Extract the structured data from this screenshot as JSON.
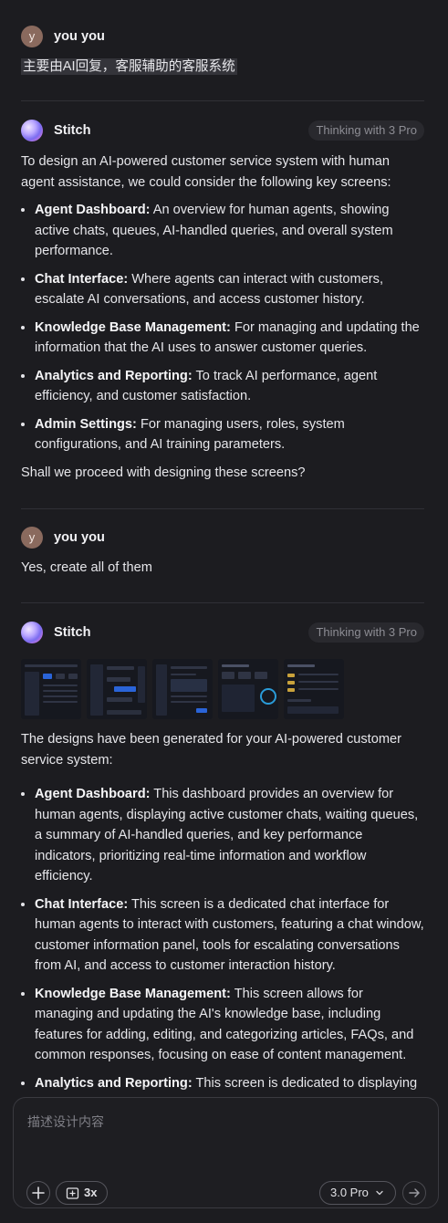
{
  "messages": {
    "m1": {
      "avatar": "y",
      "name": "you you",
      "text": "主要由AI回复，客服辅助的客服系统"
    },
    "m2": {
      "name": "Stitch",
      "badge": "Thinking with 3 Pro",
      "intro": "To design an AI-powered customer service system with human agent assistance, we could consider the following key screens:",
      "items": [
        {
          "title": "Agent Dashboard:",
          "text": " An overview for human agents, showing active chats, queues, AI-handled queries, and overall system performance."
        },
        {
          "title": "Chat Interface:",
          "text": " Where agents can interact with customers, escalate AI conversations, and access customer history."
        },
        {
          "title": "Knowledge Base Management:",
          "text": " For managing and updating the information that the AI uses to answer customer queries."
        },
        {
          "title": "Analytics and Reporting:",
          "text": " To track AI performance, agent efficiency, and customer satisfaction."
        },
        {
          "title": "Admin Settings:",
          "text": " For managing users, roles, system configurations, and AI training parameters."
        }
      ],
      "outro": "Shall we proceed with designing these screens?"
    },
    "m3": {
      "avatar": "y",
      "name": "you you",
      "text": "Yes, create all of them"
    },
    "m4": {
      "name": "Stitch",
      "badge": "Thinking with 3 Pro",
      "thumbnails": [
        "Agent Dashboard",
        "Chat Interface",
        "Knowledge Base Management",
        "Analytics and Reporting",
        "Admin Settings"
      ],
      "intro": "The designs have been generated for your AI-powered customer service system:",
      "items": [
        {
          "title": "Agent Dashboard:",
          "text": " This dashboard provides an overview for human agents, displaying active customer chats, waiting queues, a summary of AI-handled queries, and key performance indicators, prioritizing real-time information and workflow efficiency."
        },
        {
          "title": "Chat Interface:",
          "text": " This screen is a dedicated chat interface for human agents to interact with customers, featuring a chat window, customer information panel, tools for escalating conversations from AI, and access to customer interaction history."
        },
        {
          "title": "Knowledge Base Management:",
          "text": " This screen allows for managing and updating the AI's knowledge base, including features for adding, editing, and categorizing articles, FAQs, and common responses, focusing on ease of content management."
        },
        {
          "title": "Analytics and Reporting:",
          "text": " This screen is dedicated to displaying"
        }
      ]
    }
  },
  "composer": {
    "placeholder": "描述设计内容",
    "add_icon": "plus-icon",
    "screens_icon": "screens-add-icon",
    "screens_count": "3x",
    "model": "3.0 Pro",
    "model_icon": "chevron-down-icon",
    "send_icon": "arrow-right-icon"
  },
  "colors": {
    "background": "#1c1c20",
    "text": "#e6e6ea",
    "badge_bg": "#29292e",
    "accent": "#2a64d8"
  }
}
